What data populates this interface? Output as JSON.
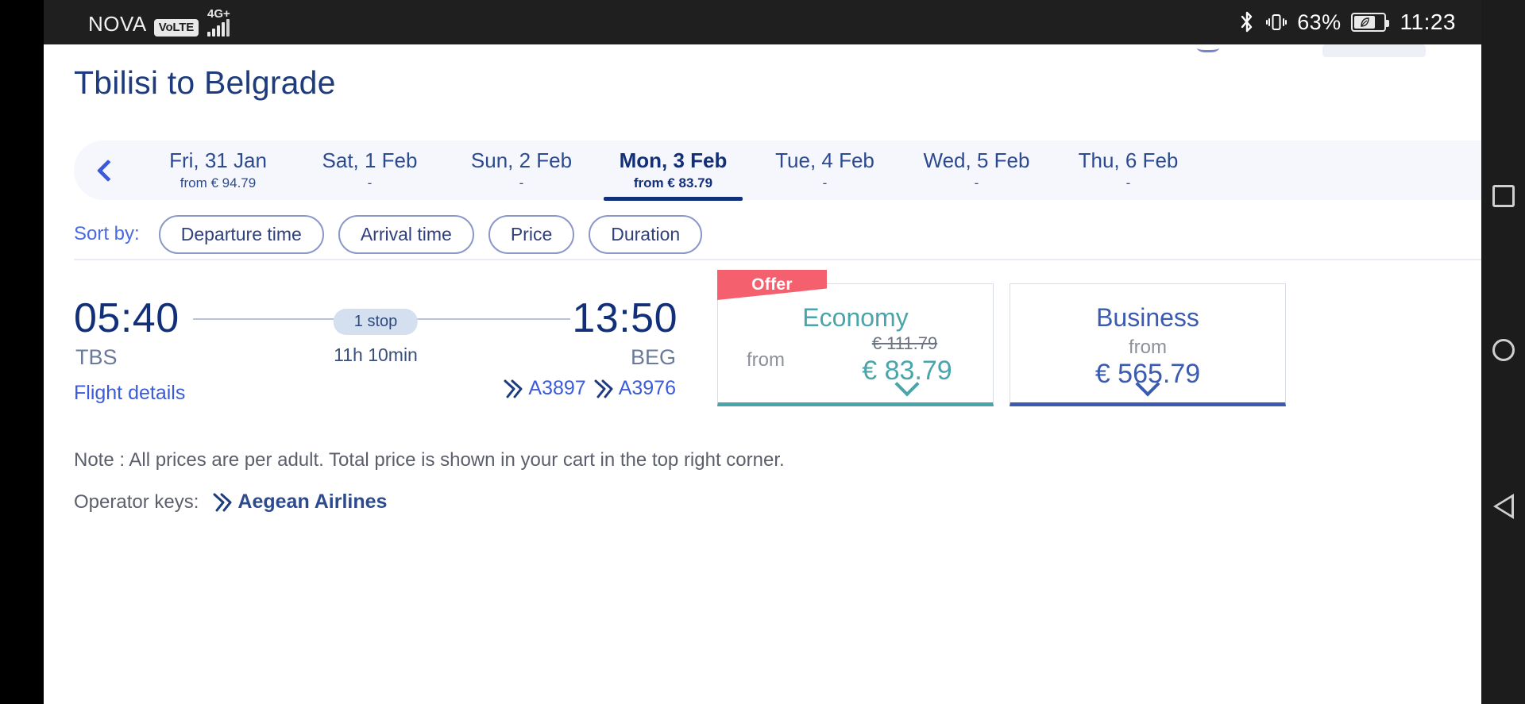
{
  "status_bar": {
    "carrier": "NOVA",
    "volte": "VoLTE",
    "network": "4G+",
    "battery_percent": "63%",
    "time": "11:23",
    "icons": [
      "bluetooth-icon",
      "vibrate-icon",
      "battery-saver-icon",
      "signal-bars-icon"
    ]
  },
  "page": {
    "title": "Tbilisi to Belgrade"
  },
  "dates": {
    "prev_label": "‹",
    "items": [
      {
        "label": "Fri, 31 Jan",
        "price": "from € 94.79",
        "selected": false
      },
      {
        "label": "Sat, 1 Feb",
        "price": "-",
        "selected": false
      },
      {
        "label": "Sun, 2 Feb",
        "price": "-",
        "selected": false
      },
      {
        "label": "Mon, 3 Feb",
        "price": "from € 83.79",
        "selected": true
      },
      {
        "label": "Tue, 4 Feb",
        "price": "-",
        "selected": false
      },
      {
        "label": "Wed, 5 Feb",
        "price": "-",
        "selected": false
      },
      {
        "label": "Thu, 6 Feb",
        "price": "-",
        "selected": false
      }
    ]
  },
  "sort": {
    "label": "Sort by:",
    "options": [
      "Departure time",
      "Arrival time",
      "Price",
      "Duration"
    ]
  },
  "flight": {
    "departure_time": "05:40",
    "departure_code": "TBS",
    "arrival_time": "13:50",
    "arrival_code": "BEG",
    "stops": "1 stop",
    "duration": "11h 10min",
    "details_link": "Flight details",
    "flight_numbers": [
      "A3897",
      "A3976"
    ]
  },
  "fares": {
    "economy": {
      "ribbon": "Offer",
      "name": "Economy",
      "from_label": "from",
      "old_price": "€ 111.79",
      "price": "€ 83.79",
      "accent": "#4aa5ab"
    },
    "business": {
      "name": "Business",
      "from_label": "from",
      "price": "€ 565.79",
      "accent": "#3a5bb0"
    }
  },
  "footer": {
    "note": "Note : All prices are per adult. Total price is shown in your cart in the top right corner.",
    "operator_keys_label": "Operator keys:",
    "operator_name": "Aegean Airlines"
  },
  "nav_bar": {
    "buttons": [
      "recents-button",
      "home-button",
      "back-button"
    ]
  }
}
